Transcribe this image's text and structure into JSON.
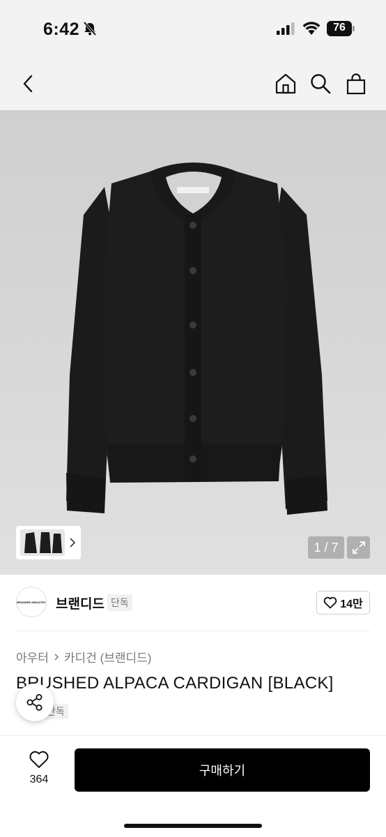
{
  "status_bar": {
    "time": "6:42",
    "battery": "76"
  },
  "nav": {
    "back_icon": "chevron-left-icon",
    "home_icon": "home-icon",
    "search_icon": "search-icon",
    "cart_icon": "shopping-bag-icon"
  },
  "gallery": {
    "counter": "1 / 7",
    "expand_icon": "expand-icon"
  },
  "brand": {
    "logo_text": "BRANDED INDUSTRY",
    "name": "브랜디드",
    "badge": "단독",
    "like_count": "14만"
  },
  "product": {
    "breadcrumb": [
      "아우터",
      "카디건 (브랜디드)"
    ],
    "title": "BRUSHED ALPACA CARDIGAN [BLACK]",
    "tag": "단독"
  },
  "bottom_bar": {
    "wish_count": "364",
    "buy_label": "구매하기"
  },
  "colors": {
    "accent": "#000000",
    "badge_bg": "#f1f1f1",
    "muted_text": "#777777"
  }
}
